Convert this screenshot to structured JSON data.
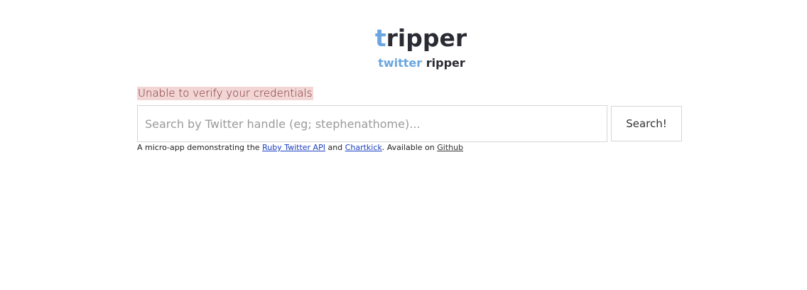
{
  "header": {
    "logo_first_letter": "t",
    "logo_rest": "ripper",
    "tagline_word_1": "twitter",
    "tagline_word_2": "ripper"
  },
  "alert": {
    "message": "Unable to verify your credentials"
  },
  "search": {
    "placeholder": "Search by Twitter handle (eg; stephenathome)...",
    "value": "",
    "button_label": "Search!"
  },
  "footer": {
    "text_1": "A micro-app demonstrating the ",
    "link_1": "Ruby Twitter API",
    "text_2": " and ",
    "link_2": "Chartkick",
    "text_3": ". Available on ",
    "link_3": "Github"
  },
  "colors": {
    "accent": "#6aa6e0",
    "alert_background": "#f2d5d5",
    "alert_text": "#7a2c2c",
    "link": "#1a3fbf"
  }
}
